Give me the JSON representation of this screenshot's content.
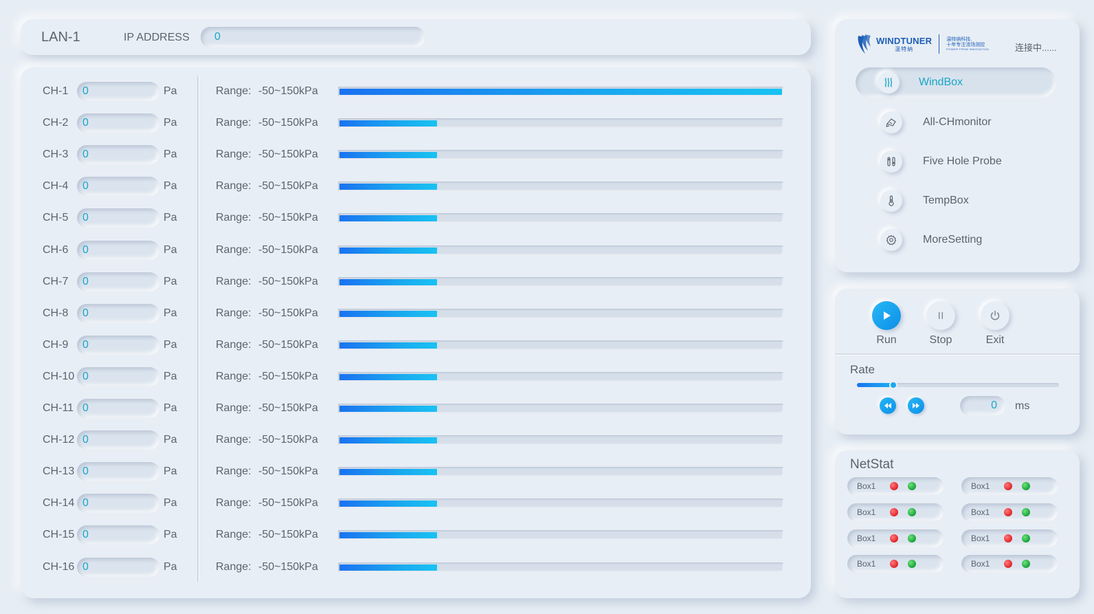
{
  "topbar": {
    "title": "LAN-1",
    "ip_label": "IP ADDRESS",
    "ip_value": "0"
  },
  "channels": [
    {
      "label": "CH-1",
      "value": "0",
      "unit": "Pa",
      "range_label": "Range:",
      "range": "-50~150kPa",
      "level": 1.0
    },
    {
      "label": "CH-2",
      "value": "0",
      "unit": "Pa",
      "range_label": "Range:",
      "range": "-50~150kPa",
      "level": 0.22
    },
    {
      "label": "CH-3",
      "value": "0",
      "unit": "Pa",
      "range_label": "Range:",
      "range": "-50~150kPa",
      "level": 0.22
    },
    {
      "label": "CH-4",
      "value": "0",
      "unit": "Pa",
      "range_label": "Range:",
      "range": "-50~150kPa",
      "level": 0.22
    },
    {
      "label": "CH-5",
      "value": "0",
      "unit": "Pa",
      "range_label": "Range:",
      "range": "-50~150kPa",
      "level": 0.22
    },
    {
      "label": "CH-6",
      "value": "0",
      "unit": "Pa",
      "range_label": "Range:",
      "range": "-50~150kPa",
      "level": 0.22
    },
    {
      "label": "CH-7",
      "value": "0",
      "unit": "Pa",
      "range_label": "Range:",
      "range": "-50~150kPa",
      "level": 0.22
    },
    {
      "label": "CH-8",
      "value": "0",
      "unit": "Pa",
      "range_label": "Range:",
      "range": "-50~150kPa",
      "level": 0.22
    },
    {
      "label": "CH-9",
      "value": "0",
      "unit": "Pa",
      "range_label": "Range:",
      "range": "-50~150kPa",
      "level": 0.22
    },
    {
      "label": "CH-10",
      "value": "0",
      "unit": "Pa",
      "range_label": "Range:",
      "range": "-50~150kPa",
      "level": 0.22
    },
    {
      "label": "CH-11",
      "value": "0",
      "unit": "Pa",
      "range_label": "Range:",
      "range": "-50~150kPa",
      "level": 0.22
    },
    {
      "label": "CH-12",
      "value": "0",
      "unit": "Pa",
      "range_label": "Range:",
      "range": "-50~150kPa",
      "level": 0.22
    },
    {
      "label": "CH-13",
      "value": "0",
      "unit": "Pa",
      "range_label": "Range:",
      "range": "-50~150kPa",
      "level": 0.22
    },
    {
      "label": "CH-14",
      "value": "0",
      "unit": "Pa",
      "range_label": "Range:",
      "range": "-50~150kPa",
      "level": 0.22
    },
    {
      "label": "CH-15",
      "value": "0",
      "unit": "Pa",
      "range_label": "Range:",
      "range": "-50~150kPa",
      "level": 0.22
    },
    {
      "label": "CH-16",
      "value": "0",
      "unit": "Pa",
      "range_label": "Range:",
      "range": "-50~150kPa",
      "level": 0.22
    }
  ],
  "brand": {
    "name": "WINDTUNER",
    "name_cn": "温特纳",
    "slogan_line1": "温特纳科技,",
    "slogan_line2": "十年专注流场测控",
    "slogan_tag": "POWER FROM INNOVATION",
    "color": "#1d5fb8"
  },
  "connection_status": "连接中......",
  "nav": {
    "items": [
      {
        "label": "WindBox",
        "icon": "heat-waves-icon",
        "active": true
      },
      {
        "label": "All-CHmonitor",
        "icon": "gauge-icon",
        "active": false
      },
      {
        "label": "Five Hole Probe",
        "icon": "probe-icon",
        "active": false
      },
      {
        "label": "TempBox",
        "icon": "thermometer-icon",
        "active": false
      },
      {
        "label": "MoreSetting",
        "icon": "gear-icon",
        "active": false
      }
    ]
  },
  "controls": {
    "run_label": "Run",
    "stop_label": "Stop",
    "exit_label": "Exit",
    "rate_label": "Rate",
    "rate_level": 0.18,
    "rate_value": "0",
    "rate_unit": "ms"
  },
  "netstat": {
    "title": "NetStat",
    "boxes": [
      {
        "name": "Box1"
      },
      {
        "name": "Box1"
      },
      {
        "name": "Box1"
      },
      {
        "name": "Box1"
      },
      {
        "name": "Box1"
      },
      {
        "name": "Box1"
      },
      {
        "name": "Box1"
      },
      {
        "name": "Box1"
      }
    ]
  },
  "colors": {
    "accent": "#1aa6c9",
    "bar_start": "#1a72f0",
    "bar_end": "#19c2f2",
    "status_red": "#e0242a",
    "status_green": "#18a23a",
    "background": "#e6edf4"
  }
}
